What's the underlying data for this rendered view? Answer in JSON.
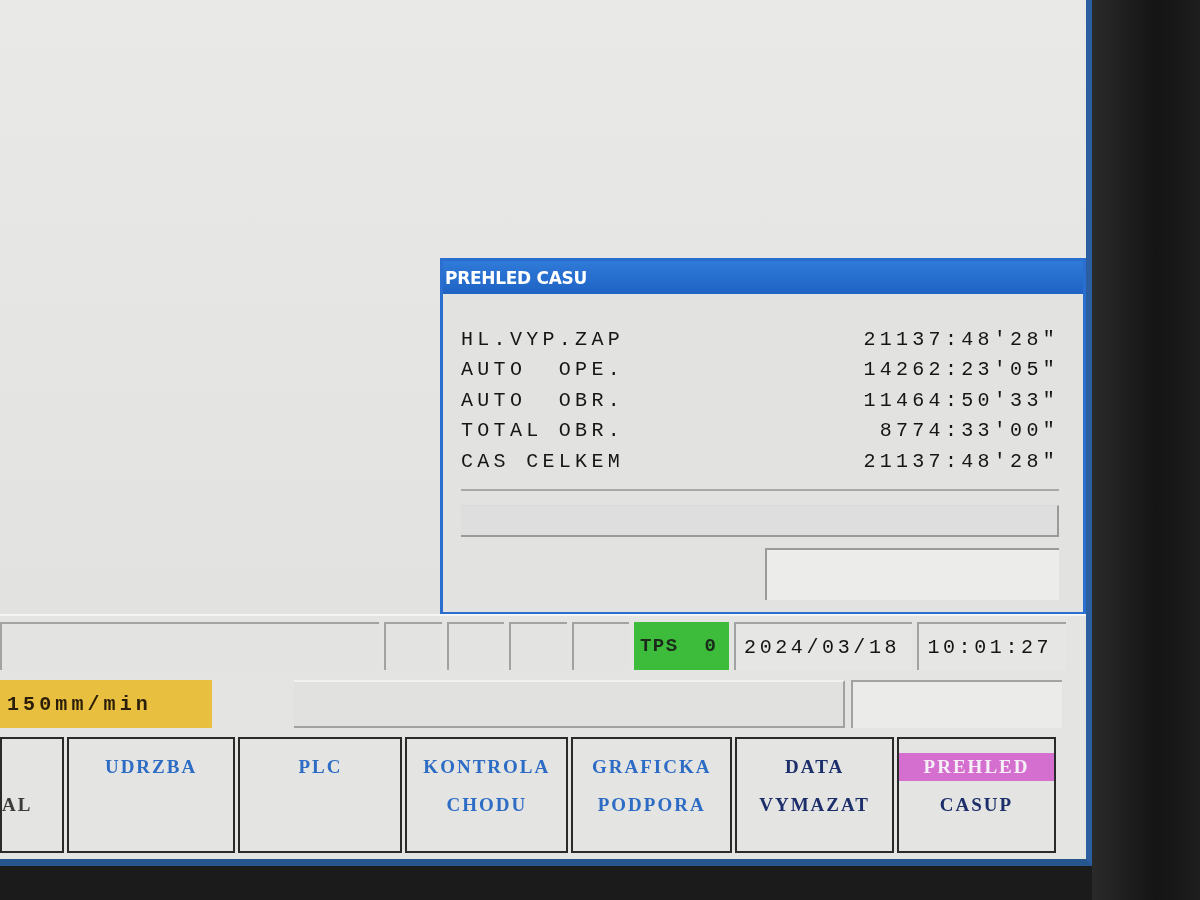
{
  "dialog": {
    "title": "PREHLED CASU",
    "rows": [
      {
        "label": "HL.VYP.ZAP",
        "value": "21137:48'28\""
      },
      {
        "label": "AUTO  OPE.",
        "value": "14262:23'05\""
      },
      {
        "label": "AUTO  OBR.",
        "value": "11464:50'33\""
      },
      {
        "label": "TOTAL OBR.",
        "value": "8774:33'00\""
      },
      {
        "label": "CAS CELKEM",
        "value": "21137:48'28\""
      }
    ]
  },
  "status_bar": {
    "tps": "TPS  0",
    "date": "2024/03/18",
    "time": "10:01:27"
  },
  "feed_rate": "150mm/min",
  "softkeys": [
    {
      "bottom": "AL",
      "selected": false,
      "color": "#3c3c3c"
    },
    {
      "top": "UDRZBA",
      "selected": false,
      "color": "#2d6cc5"
    },
    {
      "top": "PLC",
      "selected": false,
      "color": "#2d6cc5"
    },
    {
      "top": "KONTROLA",
      "bottom": "CHODU",
      "selected": false,
      "color": "#2d6cc5"
    },
    {
      "top": "GRAFICKA",
      "bottom": "PODPORA",
      "selected": false,
      "color": "#2d6cc5"
    },
    {
      "top": "DATA",
      "bottom": "VYMAZAT",
      "selected": false,
      "color": "#1d2f6b"
    },
    {
      "top": "PREHLED",
      "bottom": "CASUP",
      "selected": true,
      "color": "#1d2f6b"
    }
  ]
}
